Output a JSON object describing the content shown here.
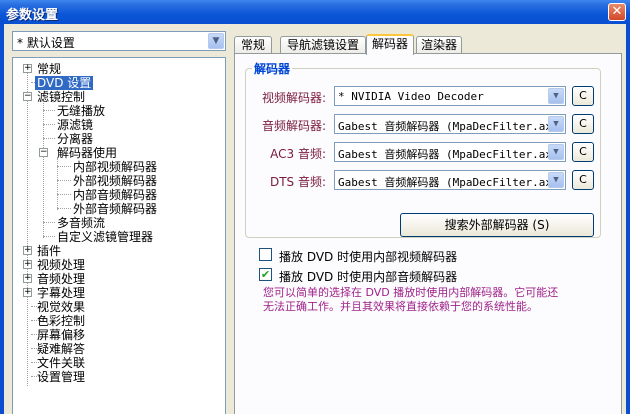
{
  "window": {
    "title": "参数设置",
    "close_glyph": "✕"
  },
  "preset": {
    "value": "* 默认设置"
  },
  "tree": {
    "items": [
      "常规",
      "DVD 设置",
      "滤镜控制",
      "无缝播放",
      "源滤镜",
      "分离器",
      "解码器使用",
      "内部视频解码器",
      "外部视频解码器",
      "内部音频解码器",
      "外部音频解码器",
      "多音频流",
      "自定义滤镜管理器",
      "插件",
      "视频处理",
      "音频处理",
      "字幕处理",
      "视觉效果",
      "色彩控制",
      "屏幕偏移",
      "疑难解答",
      "文件关联",
      "设置管理"
    ],
    "expand_glyph": "+",
    "collapse_glyph": "−"
  },
  "tabs": [
    "常规",
    "导航滤镜设置",
    "解码器",
    "渲染器"
  ],
  "decoder_group": {
    "title": "解码器",
    "rows": [
      {
        "label": "视频解码器:",
        "value": "* NVIDIA Video Decoder"
      },
      {
        "label": "音频解码器:",
        "value": "Gabest 音频解码器 (MpaDecFilter.ax)"
      },
      {
        "label": "AC3 音频:",
        "value": "Gabest 音频解码器 (MpaDecFilter.ax)"
      },
      {
        "label": "DTS 音频:",
        "value": "Gabest 音频解码器 (MpaDecFilter.ax)"
      }
    ],
    "config_label": "C",
    "search_button": "搜索外部解码器 (S)"
  },
  "options": {
    "internal_video": {
      "label": "播放 DVD 时使用内部视频解码器",
      "checked": false
    },
    "internal_audio": {
      "label": "播放 DVD 时使用内部音频解码器",
      "checked": true
    },
    "check_glyph": "✔",
    "note_line1": "您可以简单的选择在 DVD 播放时使用内部解码器。它可能还",
    "note_line2": "无法正确工作。并且其效果将直接依赖于您的系统性能。"
  },
  "icons": {
    "combo_arrow": "▼"
  }
}
